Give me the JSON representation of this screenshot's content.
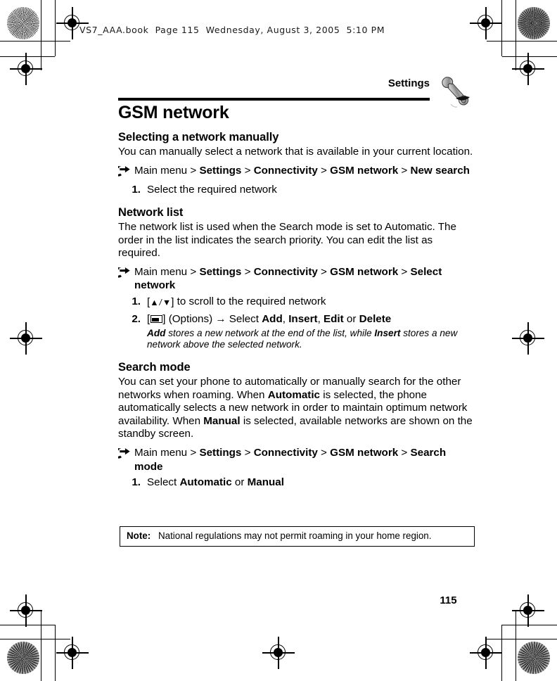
{
  "file_header": "VS7_AAA.book  Page 115  Wednesday, August 3, 2005  5:10 PM",
  "running_head": "Settings",
  "chapter_title": "GSM network",
  "page_number": "115",
  "icons": {
    "chapter": "wrench-icon",
    "nav_bullet": "curved-right-arrow-icon",
    "scroll_keys": "up-down-arrow-keys-icon",
    "soft_key": "left-softkey-icon",
    "then": "right-arrow-icon"
  },
  "sections": [
    {
      "heading": "Selecting a network manually",
      "paragraph": "You can manually select a network that is available in your current location.",
      "nav_path": [
        {
          "text": "Main menu",
          "bold": false
        },
        {
          "text": " > ",
          "bold": false
        },
        {
          "text": "Settings",
          "bold": true
        },
        {
          "text": " > ",
          "bold": false
        },
        {
          "text": "Connectivity",
          "bold": true
        },
        {
          "text": " > ",
          "bold": false
        },
        {
          "text": "GSM network",
          "bold": true
        },
        {
          "text": " > ",
          "bold": false
        },
        {
          "text": "New search",
          "bold": true
        }
      ],
      "steps": [
        {
          "num": "1.",
          "parts": [
            {
              "text": "Select the required network",
              "bold": false
            }
          ]
        }
      ]
    },
    {
      "heading": "Network list",
      "paragraph": "The network list is used when the Search mode is set to Automatic. The order in the list indicates the search priority. You can edit the list as required.",
      "nav_path": [
        {
          "text": "Main menu",
          "bold": false
        },
        {
          "text": " > ",
          "bold": false
        },
        {
          "text": "Settings",
          "bold": true
        },
        {
          "text": " > ",
          "bold": false
        },
        {
          "text": "Connectivity",
          "bold": true
        },
        {
          "text": " > ",
          "bold": false
        },
        {
          "text": "GSM network",
          "bold": true
        },
        {
          "text": " > ",
          "bold": false
        },
        {
          "text": "Select network",
          "bold": true
        }
      ],
      "steps": [
        {
          "num": "1.",
          "glyph": "scroll_keys",
          "parts": [
            {
              "text": " to scroll to the required network",
              "bold": false
            }
          ]
        },
        {
          "num": "2.",
          "glyph": "soft_key",
          "parts": [
            {
              "text": " (Options) ",
              "bold": false
            },
            {
              "text": "→",
              "bold": false
            },
            {
              "text": " Select ",
              "bold": false
            },
            {
              "text": "Add",
              "bold": true
            },
            {
              "text": ", ",
              "bold": false
            },
            {
              "text": "Insert",
              "bold": true
            },
            {
              "text": ", ",
              "bold": false
            },
            {
              "text": "Edit",
              "bold": true
            },
            {
              "text": " or ",
              "bold": false
            },
            {
              "text": "Delete",
              "bold": true
            }
          ],
          "note_parts": [
            {
              "text": "Add",
              "bold": true
            },
            {
              "text": " stores a new network at the end of the list, while ",
              "bold": false
            },
            {
              "text": "Insert",
              "bold": true
            },
            {
              "text": " stores a new network above the selected network.",
              "bold": false
            }
          ]
        }
      ]
    },
    {
      "heading": "Search mode",
      "paragraph_parts": [
        {
          "text": "You can set your phone to automatically or manually search for the other networks when roaming. When ",
          "bold": false
        },
        {
          "text": "Automatic",
          "bold": true
        },
        {
          "text": " is selected, the phone automatically selects a new network in order to maintain optimum network availability. When ",
          "bold": false
        },
        {
          "text": "Manual",
          "bold": true
        },
        {
          "text": " is selected, available networks are shown on the standby screen.",
          "bold": false
        }
      ],
      "nav_path": [
        {
          "text": "Main menu",
          "bold": false
        },
        {
          "text": " > ",
          "bold": false
        },
        {
          "text": "Settings",
          "bold": true
        },
        {
          "text": " > ",
          "bold": false
        },
        {
          "text": "Connectivity",
          "bold": true
        },
        {
          "text": " > ",
          "bold": false
        },
        {
          "text": "GSM network",
          "bold": true
        },
        {
          "text": " > ",
          "bold": false
        },
        {
          "text": "Search mode",
          "bold": true
        }
      ],
      "steps": [
        {
          "num": "1.",
          "parts": [
            {
              "text": "Select ",
              "bold": false
            },
            {
              "text": "Automatic",
              "bold": true
            },
            {
              "text": " or ",
              "bold": false
            },
            {
              "text": "Manual",
              "bold": true
            }
          ]
        }
      ]
    }
  ],
  "note": {
    "label": "Note:",
    "text": "National regulations may not permit roaming in your home region."
  }
}
